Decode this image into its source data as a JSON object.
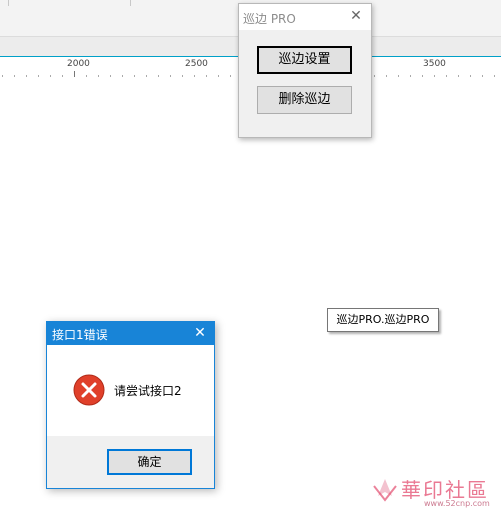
{
  "ruler": {
    "labels": [
      "2000",
      "2500",
      "3500"
    ]
  },
  "pro_dialog": {
    "title": "巡边 PRO",
    "close_glyph": "✕",
    "buttons": {
      "settings": "巡边设置",
      "delete": "删除巡边"
    }
  },
  "tooltip": {
    "text": "巡边PRO.巡边PRO"
  },
  "error_dialog": {
    "title": "接口1错误",
    "close_glyph": "✕",
    "icon": "error-icon",
    "message": "请尝试接口2",
    "ok_label": "确定"
  },
  "watermark": {
    "text": "華印社區",
    "url": "www.52cnp.com"
  },
  "colors": {
    "accent": "#1884d7",
    "error": "#e0402a",
    "watermark": "#e34d6f"
  }
}
